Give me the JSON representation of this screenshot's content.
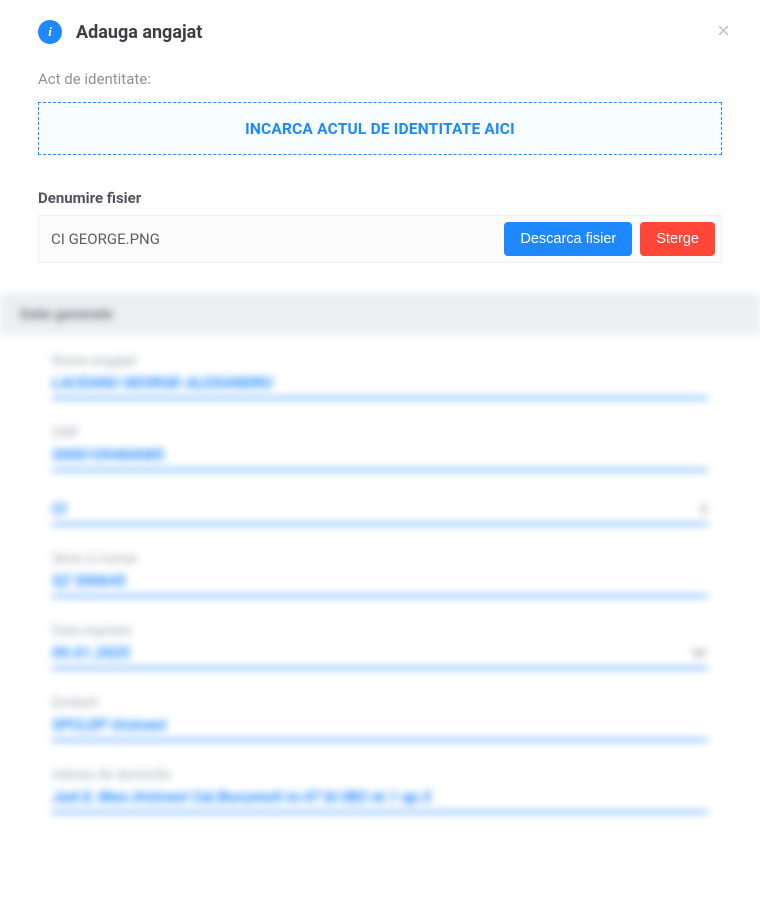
{
  "modal": {
    "title": "Adauga angajat",
    "close_symbol": "×"
  },
  "identity": {
    "label": "Act de identitate:",
    "upload_cta": "INCARCA ACTUL DE IDENTITATE AICI"
  },
  "file": {
    "header": "Denumire fisier",
    "name": "CI GEORGE.PNG",
    "download_label": "Descarca fisier",
    "delete_label": "Sterge"
  },
  "general": {
    "section_title": "Date generale",
    "fields": {
      "employee_name": {
        "label": "Nume angajat",
        "value": "LACEANU GEORGE-ALEXANDRU"
      },
      "cnp": {
        "label": "CNP",
        "value": "5000109460085"
      },
      "doc_type": {
        "label": "",
        "value": "CI"
      },
      "series_number": {
        "label": "Serie si numar",
        "value": "SZ 500645"
      },
      "expiry": {
        "label": "Data expirare",
        "value": "09.01.2025"
      },
      "issuer": {
        "label": "Emitent",
        "value": "SPCLEP Urziceni"
      },
      "address": {
        "label": "Adresa de domiciliu",
        "value": "Jud.IL Mun.Urziceni Cal.Bucuresti nr.47 bl.0B2 et.1 ap.5"
      }
    }
  }
}
